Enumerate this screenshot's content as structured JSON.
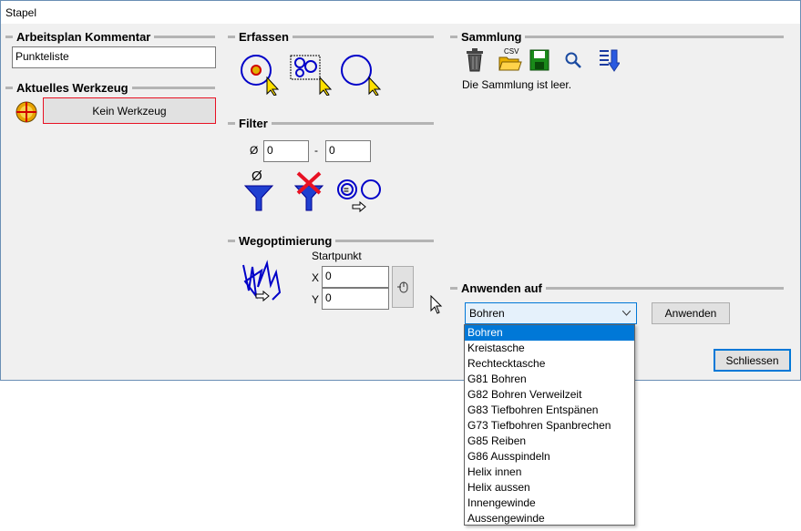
{
  "window": {
    "title": "Stapel"
  },
  "groups": {
    "comment": {
      "title": "Arbeitsplan Kommentar",
      "value": "Punkteliste"
    },
    "tool": {
      "title": "Aktuelles Werkzeug",
      "button": "Kein Werkzeug"
    },
    "capture": {
      "title": "Erfassen"
    },
    "filter": {
      "title": "Filter",
      "diameter_symbol": "Ø",
      "dash": "-",
      "min": "0",
      "max": "0",
      "funnel_symbol": "Ø"
    },
    "path": {
      "title": "Wegoptimierung",
      "start_label": "Startpunkt",
      "x_label": "X",
      "y_label": "Y",
      "x_value": "0",
      "y_value": "0"
    },
    "collection": {
      "title": "Sammlung",
      "csv": "CSV",
      "empty_text": "Die Sammlung ist leer."
    },
    "apply": {
      "title": "Anwenden auf",
      "selected": "Bohren",
      "apply_button": "Anwenden"
    }
  },
  "dropdown_options": [
    "Bohren",
    "Kreistasche",
    "Rechtecktasche",
    "G81 Bohren",
    "G82 Bohren Verweilzeit",
    "G83 Tiefbohren Entspänen",
    "G73 Tiefbohren Spanbrechen",
    "G85 Reiben",
    "G86 Ausspindeln",
    "Helix innen",
    "Helix aussen",
    "Innengewinde",
    "Aussengewinde"
  ],
  "close_button": "Schliessen",
  "colors": {
    "accent": "#0078d7",
    "warning_border": "#e81123",
    "icon_blue": "#0000c8"
  }
}
